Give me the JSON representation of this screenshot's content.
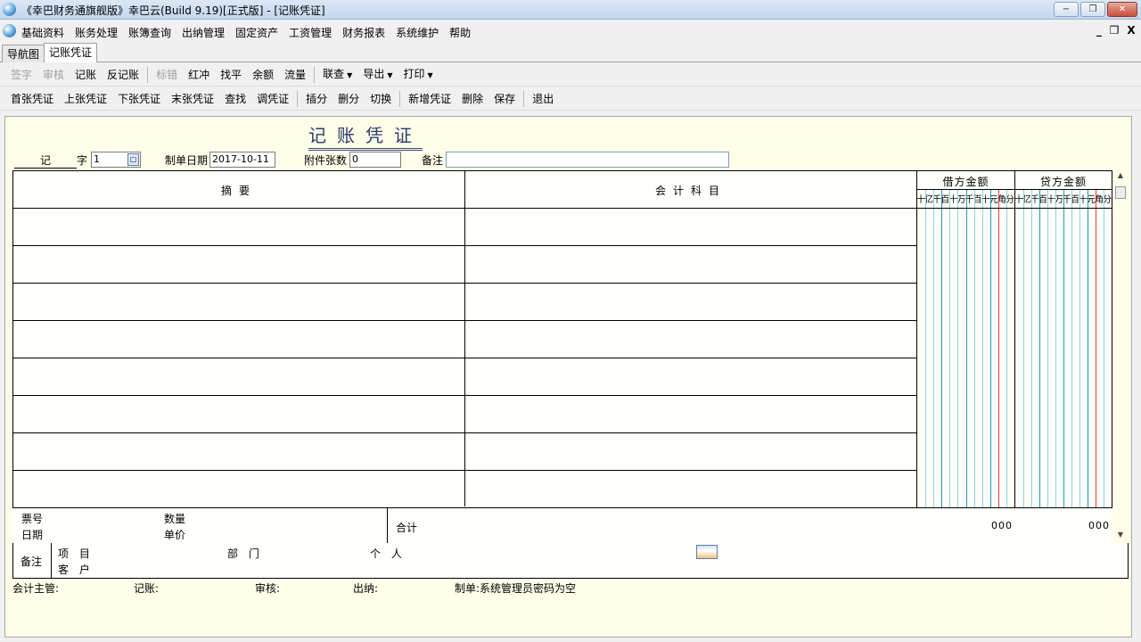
{
  "window": {
    "title": "《幸巴财务通旗舰版》幸巴云(Build 9.19)[正式版] - [记账凭证]",
    "min": "−",
    "restore": "❐",
    "close": "✕"
  },
  "menu": {
    "items": [
      "基础资料",
      "账务处理",
      "账簿查询",
      "出纳管理",
      "固定资产",
      "工资管理",
      "财务报表",
      "系统维护",
      "帮助"
    ],
    "mdi_min": "_",
    "mdi_restore": "❐",
    "mdi_close": "X"
  },
  "tabs": [
    "导航图",
    "记账凭证"
  ],
  "toolbar1": {
    "sign": "签字",
    "review": "审核",
    "post": "记账",
    "unpost": "反记账",
    "flag": "标错",
    "red": "红冲",
    "balance": "找平",
    "remain": "余额",
    "flow": "流量",
    "query": "联查",
    "export": "导出",
    "print": "打印"
  },
  "toolbar2": [
    "首张凭证",
    "上张凭证",
    "下张凭证",
    "末张凭证",
    "查找",
    "调凭证",
    "插分",
    "删分",
    "切换",
    "新增凭证",
    "删除",
    "保存",
    "退出"
  ],
  "voucher": {
    "title": "记账凭证",
    "type": "记",
    "zi": "字",
    "number": "1",
    "date_label": "制单日期",
    "date": "2017-10-11",
    "attach_label": "附件张数",
    "attach": "0",
    "note_label": "备注",
    "note": "",
    "col_summary": "摘要",
    "col_account": "会计科目",
    "col_debit": "借方金额",
    "col_credit": "贷方金额",
    "digits": [
      "十",
      "亿",
      "千",
      "百",
      "十",
      "万",
      "千",
      "百",
      "十",
      "元",
      "角",
      "分"
    ],
    "ticket_no": "票号",
    "ticket_date": "日期",
    "qty": "数量",
    "unit_price": "单价",
    "total": "合计",
    "debit_total": "000",
    "credit_total": "000",
    "remark_label": "备注",
    "project": "项 目",
    "dept": "部 门",
    "person": "个 人",
    "customer": "客 户"
  },
  "signatures": {
    "supervisor": "会计主管:",
    "bookkeeper": "记账:",
    "reviewer": "审核:",
    "cashier": "出纳:",
    "preparer": "制单:系统管理员密码为空"
  }
}
